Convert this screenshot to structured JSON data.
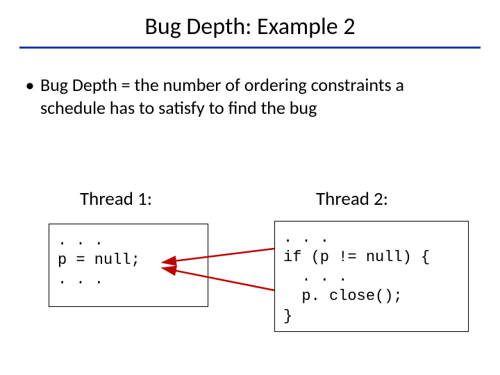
{
  "title": "Bug Depth: Example 2",
  "bullet": {
    "marker": "•",
    "text": "Bug Depth = the number of ordering constraints a schedule has to satisfy to find the bug"
  },
  "thread1": {
    "label": "Thread 1:",
    "code": ". . .\np = null;\n. . ."
  },
  "thread2": {
    "label": "Thread 2:",
    "code": ". . .\nif (p != null) {\n  . . .\n  p. close();\n}"
  },
  "colors": {
    "rule": "#1f3ca6",
    "arrow": "#c00000"
  }
}
